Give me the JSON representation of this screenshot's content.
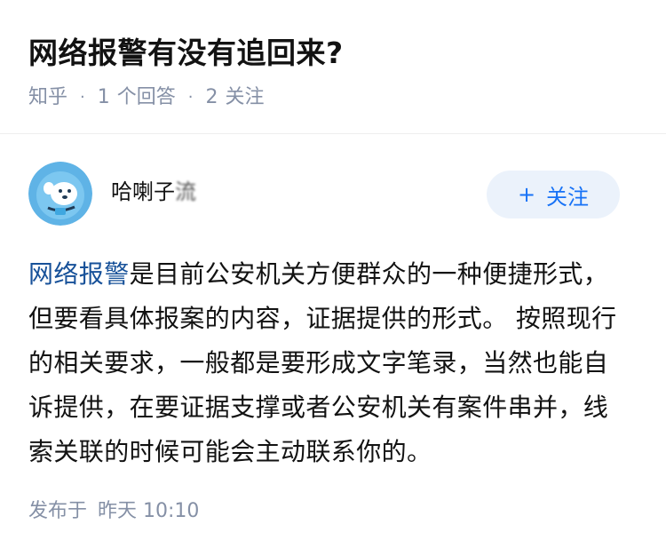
{
  "question": {
    "title": "网络报警有没有追回来?",
    "source": "知乎",
    "answer_count": "1",
    "answer_label": "个回答",
    "follower_count": "2",
    "follower_label": "关注"
  },
  "author": {
    "name_visible": "哈喇子",
    "name_blurred": "流",
    "follow_label": "关注",
    "follow_icon": "plus-icon"
  },
  "answer": {
    "link_text": "网络报警",
    "text": "是目前公安机关方便群众的一种便捷形式，但要看具体报案的内容，证据提供的形式。 按照现行的相关要求，一般都是要形成文字笔录，当然也能自诉提供，在要证据支撑或者公安机关有案件串并，线索关联的时候可能会主动联系你的。"
  },
  "footer": {
    "publish_label": "发布于",
    "publish_time": "昨天 10:10"
  },
  "colors": {
    "link": "#175199",
    "follow_text": "#1772f6",
    "follow_bg": "#ebf2fb",
    "meta": "#8590a6"
  }
}
